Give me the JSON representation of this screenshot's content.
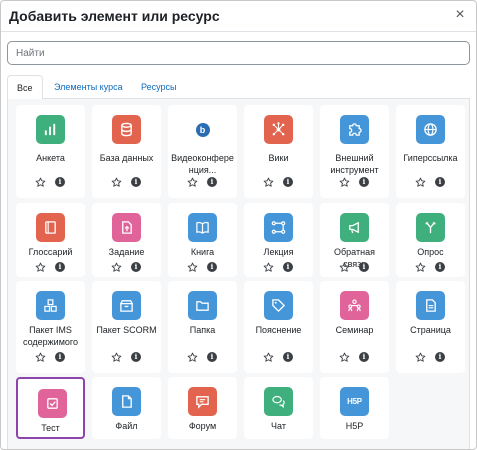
{
  "dialog": {
    "title": "Добавить элемент или ресурс",
    "close_glyph": "×"
  },
  "search": {
    "placeholder": "Найти",
    "value": ""
  },
  "tabs": [
    {
      "label": "Все",
      "active": true
    },
    {
      "label": "Элементы курса",
      "active": false
    },
    {
      "label": "Ресурсы",
      "active": false
    }
  ],
  "colors": {
    "green": "#3fb07d",
    "orange": "#e2644f",
    "pink": "#e0649a",
    "blue": "#4596d9",
    "selected_border": "#8e44ad",
    "link": "#0f6cbf"
  },
  "modules": [
    {
      "label": "Анкета",
      "icon": "chart-bar-icon",
      "color": "#3fb07d"
    },
    {
      "label": "База данных",
      "icon": "database-icon",
      "color": "#e2644f"
    },
    {
      "label": "Видеоконфере нция...",
      "icon": "bigbluebutton-icon",
      "color": "#ffffff"
    },
    {
      "label": "Вики",
      "icon": "wiki-network-icon",
      "color": "#e2644f"
    },
    {
      "label": "Внешний инструмент",
      "icon": "puzzle-icon",
      "color": "#4596d9"
    },
    {
      "label": "Гиперссылка",
      "icon": "globe-icon",
      "color": "#4596d9"
    },
    {
      "label": "Глоссарий",
      "icon": "book-icon",
      "color": "#e2644f"
    },
    {
      "label": "Задание",
      "icon": "assignment-upload-icon",
      "color": "#e0649a"
    },
    {
      "label": "Книга",
      "icon": "open-book-icon",
      "color": "#4596d9"
    },
    {
      "label": "Лекция",
      "icon": "lesson-path-icon",
      "color": "#4596d9"
    },
    {
      "label": "Обратная связь",
      "icon": "megaphone-icon",
      "color": "#3fb07d"
    },
    {
      "label": "Опрос",
      "icon": "choice-fork-icon",
      "color": "#3fb07d"
    },
    {
      "label": "Пакет IMS содержимого",
      "icon": "cubes-icon",
      "color": "#4596d9"
    },
    {
      "label": "Пакет SCORM",
      "icon": "package-box-icon",
      "color": "#4596d9"
    },
    {
      "label": "Папка",
      "icon": "folder-icon",
      "color": "#4596d9"
    },
    {
      "label": "Пояснение",
      "icon": "tag-icon",
      "color": "#4596d9"
    },
    {
      "label": "Семинар",
      "icon": "workshop-people-icon",
      "color": "#e0649a"
    },
    {
      "label": "Страница",
      "icon": "page-document-icon",
      "color": "#4596d9"
    },
    {
      "label": "Тест",
      "icon": "quiz-check-icon",
      "color": "#e0649a",
      "selected": true
    },
    {
      "label": "Файл",
      "icon": "file-icon",
      "color": "#4596d9"
    },
    {
      "label": "Форум",
      "icon": "forum-bubble-icon",
      "color": "#e2644f"
    },
    {
      "label": "Чат",
      "icon": "chat-bubbles-icon",
      "color": "#3fb07d"
    },
    {
      "label": "H5P",
      "icon": "h5p-icon",
      "color": "#4596d9"
    }
  ],
  "card_actions": {
    "star_icon": "star-outline-icon",
    "info_icon": "info-circle-icon",
    "info_glyph": "i"
  }
}
